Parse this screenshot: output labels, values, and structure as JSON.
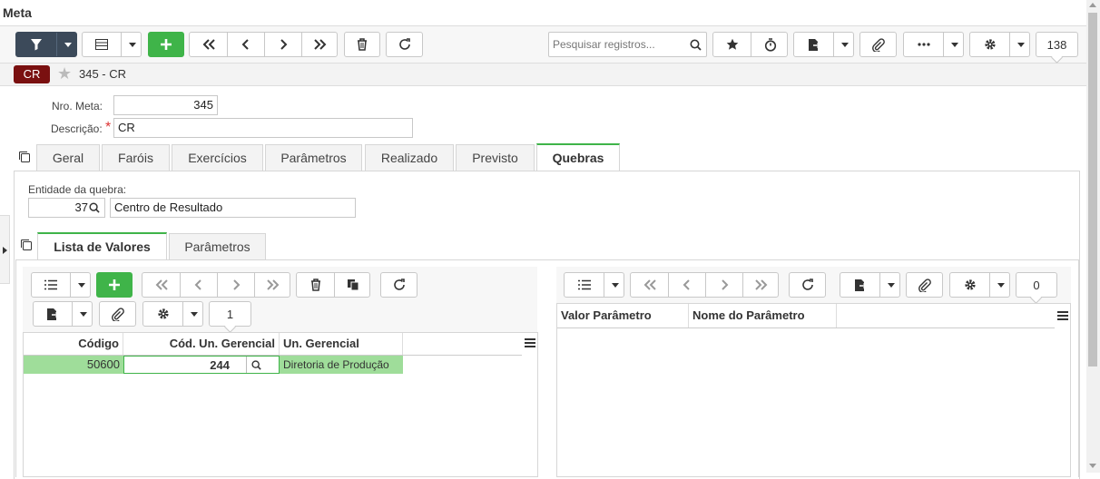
{
  "window": {
    "title": "Meta"
  },
  "toolbar": {
    "search_placeholder": "Pesquisar registros...",
    "record_count": "138"
  },
  "record": {
    "badge": "CR",
    "title": "345 - CR"
  },
  "form": {
    "nro_meta_label": "Nro. Meta:",
    "nro_meta_value": "345",
    "descricao_label": "Descrição:",
    "descricao_required": "*",
    "descricao_value": "CR"
  },
  "tabs": [
    {
      "label": "Geral"
    },
    {
      "label": "Faróis"
    },
    {
      "label": "Exercícios"
    },
    {
      "label": "Parâmetros"
    },
    {
      "label": "Realizado"
    },
    {
      "label": "Previsto"
    },
    {
      "label": "Quebras"
    }
  ],
  "quebras": {
    "entidade_label": "Entidade da quebra:",
    "entidade_code": "37",
    "entidade_name": "Centro de Resultado"
  },
  "subtabs": [
    {
      "label": "Lista de Valores"
    },
    {
      "label": "Parâmetros"
    }
  ],
  "left_grid": {
    "record_count": "1",
    "headers": [
      "Código",
      "Cód. Un. Gerencial",
      "Un. Gerencial"
    ],
    "rows": [
      {
        "codigo": "50600",
        "cod_un": "244",
        "un": "Diretoria de Produção"
      }
    ]
  },
  "right_grid": {
    "record_count": "0",
    "headers": [
      "Valor Parâmetro",
      "Nome do Parâmetro"
    ]
  },
  "colors": {
    "accent": "#3fb449",
    "dark": "#3c4a5a",
    "badge": "#7a1010"
  }
}
